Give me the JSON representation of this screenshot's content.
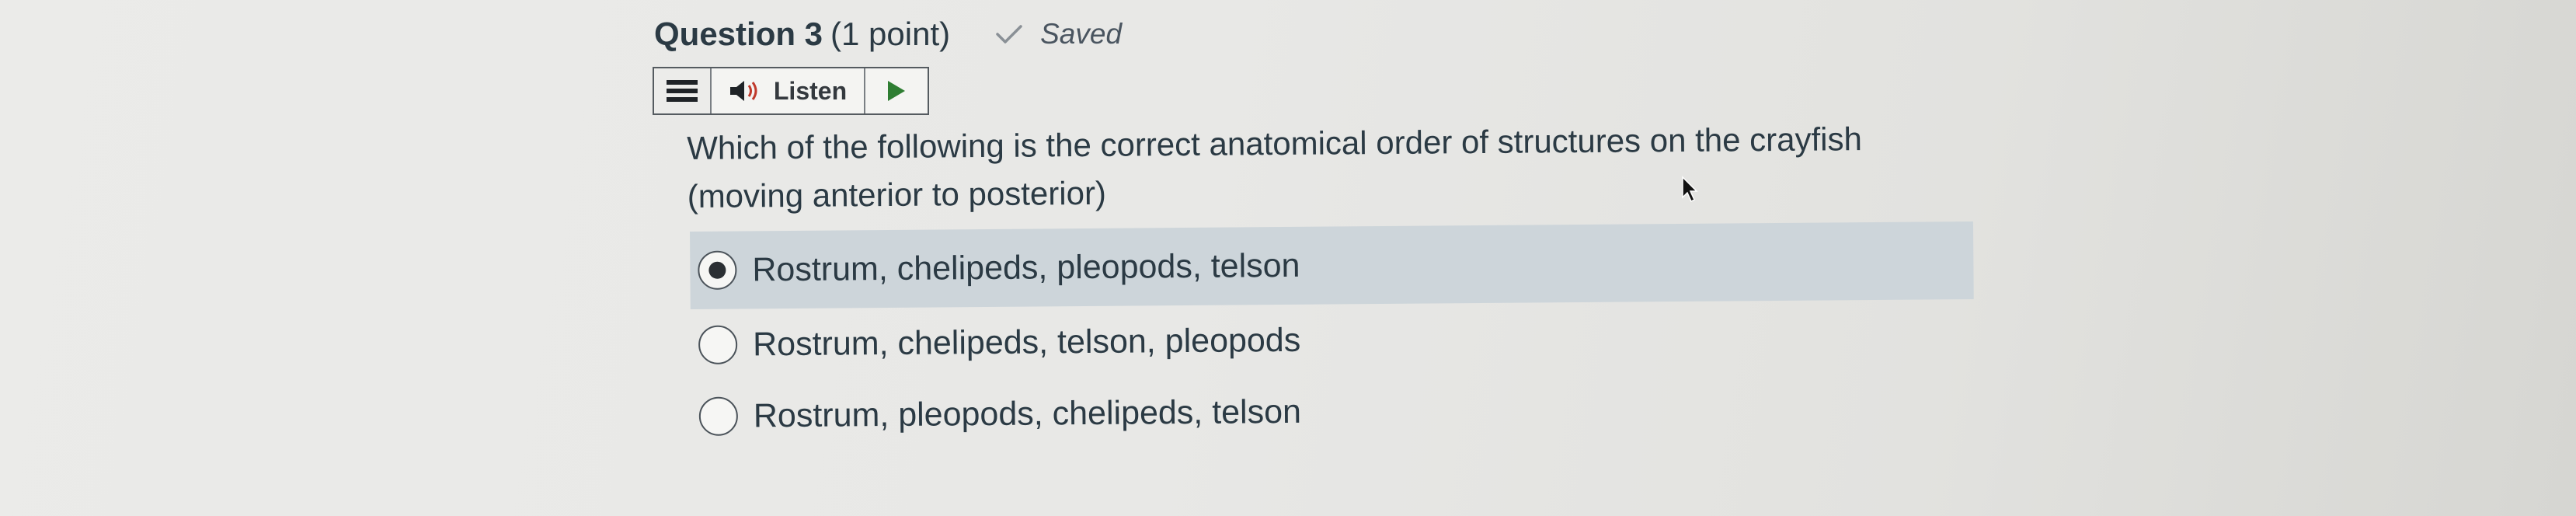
{
  "question": {
    "title": "Question 3",
    "points": "(1 point)",
    "status": "Saved",
    "prompt": "Which of the following is the correct anatomical order of structures on the crayfish (moving anterior to posterior)"
  },
  "toolbar": {
    "listen_label": "Listen"
  },
  "answers": [
    {
      "label": "Rostrum, chelipeds, pleopods, telson",
      "selected": true
    },
    {
      "label": "Rostrum, chelipeds, telson, pleopods",
      "selected": false
    },
    {
      "label": "Rostrum, pleopods, chelipeds, telson",
      "selected": false
    }
  ],
  "colors": {
    "selected_row": "#cdd5da",
    "text": "#2b3a44",
    "background": "#e8e8e6"
  }
}
